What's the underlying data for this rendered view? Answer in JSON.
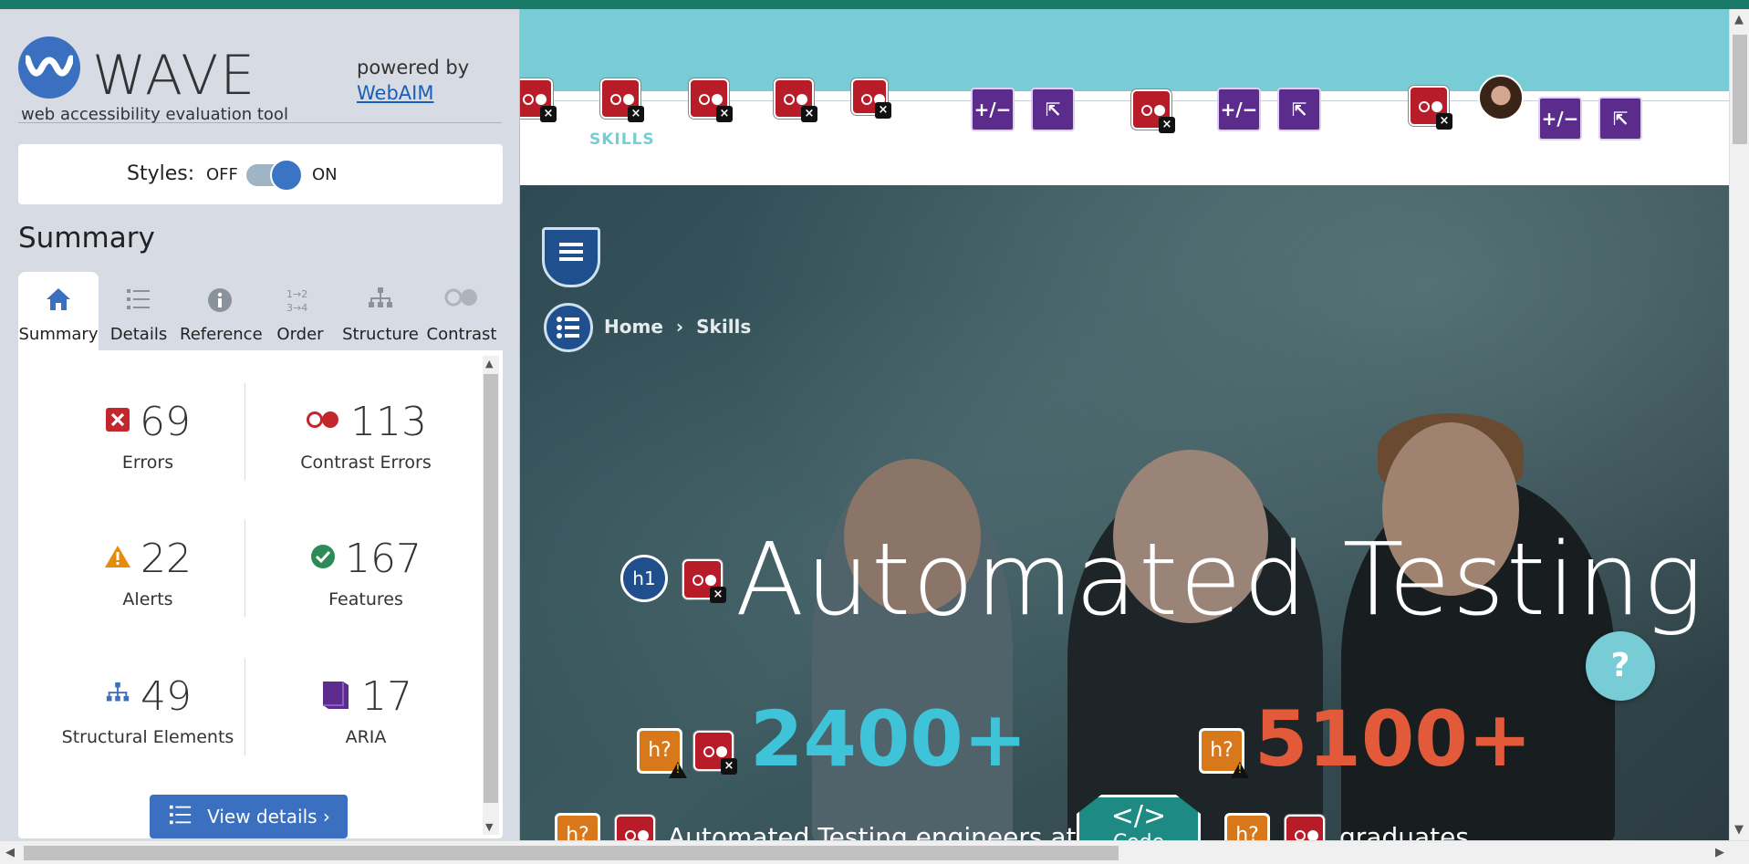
{
  "wave": {
    "title": "WAVE",
    "subtitle": "web accessibility evaluation tool",
    "powered_by": "powered by",
    "webaim_link": "WebAIM",
    "styles_label": "Styles:",
    "styles_off": "OFF",
    "styles_on": "ON",
    "summary_heading": "Summary",
    "tabs": [
      {
        "label": "Summary",
        "icon": "home-icon"
      },
      {
        "label": "Details",
        "icon": "list-icon"
      },
      {
        "label": "Reference",
        "icon": "info-icon"
      },
      {
        "label": "Order",
        "icon": "order-icon"
      },
      {
        "label": "Structure",
        "icon": "structure-icon"
      },
      {
        "label": "Contrast",
        "icon": "contrast-icon"
      }
    ],
    "stats": {
      "errors": {
        "count": "69",
        "label": "Errors"
      },
      "contrast_errors": {
        "count": "113",
        "label": "Contrast Errors"
      },
      "alerts": {
        "count": "22",
        "label": "Alerts"
      },
      "features": {
        "count": "167",
        "label": "Features"
      },
      "structural": {
        "count": "49",
        "label": "Structural Elements"
      },
      "aria": {
        "count": "17",
        "label": "ARIA"
      }
    },
    "view_details": "View details ›",
    "colors": {
      "accent": "#3b6fc0",
      "error": "#c3272e",
      "alert": "#e48b0c",
      "feature": "#2e8b57",
      "aria": "#5b2c8c"
    }
  },
  "page": {
    "nav_skills": "SKILLS",
    "breadcrumb": {
      "home": "Home",
      "separator": "›",
      "current": "Skills"
    },
    "hero_title": "Automated Testing",
    "stat_a": "2400+",
    "stat_b": "5100+",
    "bottom_text_a": "Automated Testing engineers at",
    "bottom_text_b": "graduates",
    "code_badge_symbol": "</>",
    "code_badge_label": "Code",
    "help_symbol": "?",
    "h1_badge": "h1",
    "h_badge": "h?",
    "plus_minus": "+/−"
  }
}
